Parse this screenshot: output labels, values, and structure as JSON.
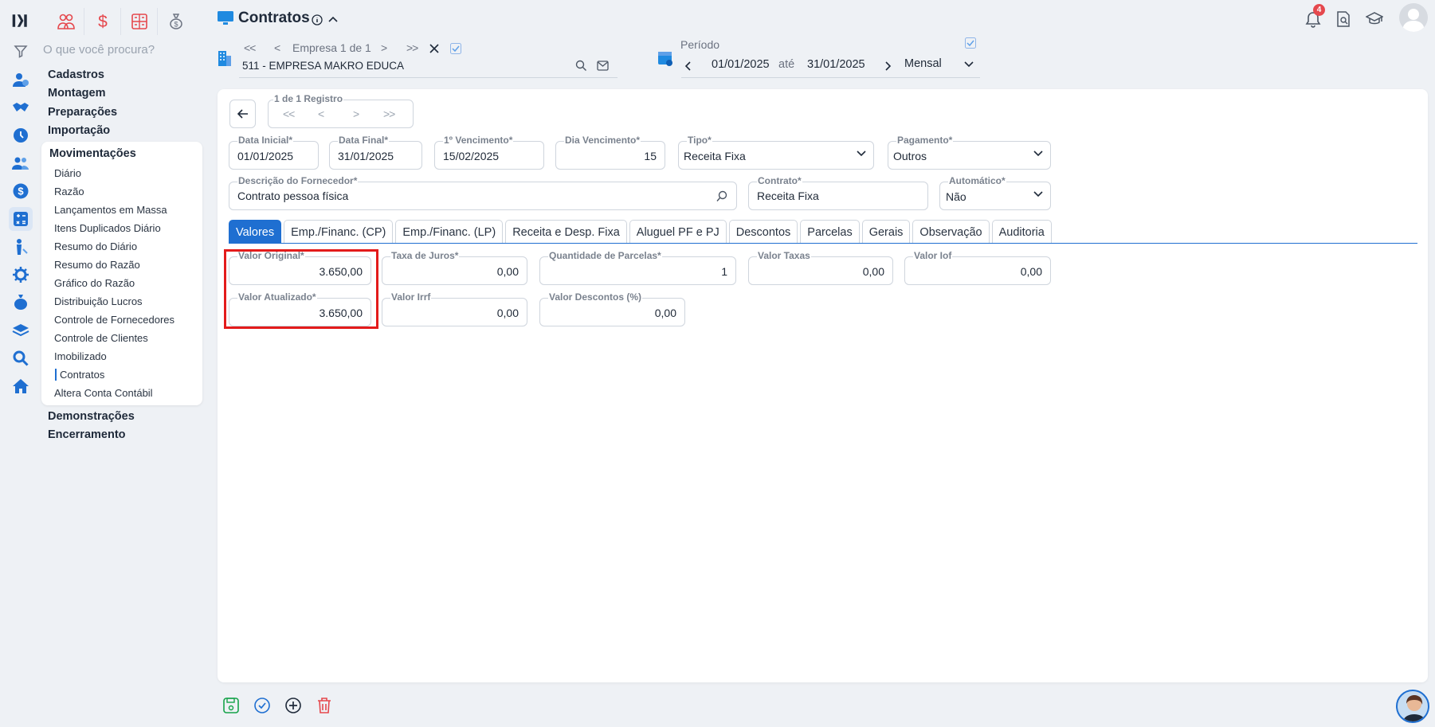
{
  "search": {
    "placeholder": "O que você procura?"
  },
  "nav": {
    "sections_top": [
      "Cadastros",
      "Montagem",
      "Preparações",
      "Importação"
    ],
    "open_section": "Movimentações",
    "sub_items": [
      "Diário",
      "Razão",
      "Lançamentos em Massa",
      "Itens Duplicados Diário",
      "Resumo do Diário",
      "Resumo do Razão",
      "Gráfico do Razão",
      "Distribuição Lucros",
      "Controle de Fornecedores",
      "Controle de Clientes",
      "Imobilizado",
      "Contratos",
      "Altera Conta Contábil"
    ],
    "sections_bottom": [
      "Demonstrações",
      "Encerramento"
    ]
  },
  "header": {
    "title": "Contratos",
    "company_pager": "Empresa 1 de 1",
    "company": "511 - EMPRESA MAKRO EDUCA",
    "period_label": "Período",
    "date_from": "01/01/2025",
    "date_sep": "até",
    "date_to": "31/01/2025",
    "periodicity": "Mensal",
    "notifications": "4"
  },
  "record_pager": {
    "label": "1 de 1 Registro"
  },
  "form": {
    "data_inicial": {
      "label": "Data Inicial*",
      "value": "01/01/2025"
    },
    "data_final": {
      "label": "Data Final*",
      "value": "31/01/2025"
    },
    "primeiro_venc": {
      "label": "1º Vencimento*",
      "value": "15/02/2025"
    },
    "dia_venc": {
      "label": "Dia Vencimento*",
      "value": "15"
    },
    "tipo": {
      "label": "Tipo*",
      "value": "Receita Fixa"
    },
    "pagamento": {
      "label": "Pagamento*",
      "value": "Outros"
    },
    "descricao": {
      "label": "Descrição do Fornecedor*",
      "value": "Contrato pessoa física"
    },
    "contrato": {
      "label": "Contrato*",
      "value": "Receita Fixa"
    },
    "automatico": {
      "label": "Automático*",
      "value": "Não"
    }
  },
  "tabs": [
    "Valores",
    "Emp./Financ. (CP)",
    "Emp./Financ. (LP)",
    "Receita e Desp. Fixa",
    "Aluguel PF e PJ",
    "Descontos",
    "Parcelas",
    "Gerais",
    "Observação",
    "Auditoria"
  ],
  "valores": {
    "valor_original": {
      "label": "Valor Original*",
      "value": "3.650,00"
    },
    "taxa_juros": {
      "label": "Taxa de Juros*",
      "value": "0,00"
    },
    "qtd_parcelas": {
      "label": "Quantidade de Parcelas*",
      "value": "1"
    },
    "valor_taxas": {
      "label": "Valor Taxas",
      "value": "0,00"
    },
    "valor_iof": {
      "label": "Valor Iof",
      "value": "0,00"
    },
    "valor_atualizado": {
      "label": "Valor Atualizado*",
      "value": "3.650,00"
    },
    "valor_irrf": {
      "label": "Valor Irrf",
      "value": "0,00"
    },
    "valor_descontos": {
      "label": "Valor Descontos (%)",
      "value": "0,00"
    }
  },
  "colors": {
    "accent": "#1f6fd1",
    "highlight": "#e31b1b",
    "module_red": "#e5484d"
  }
}
